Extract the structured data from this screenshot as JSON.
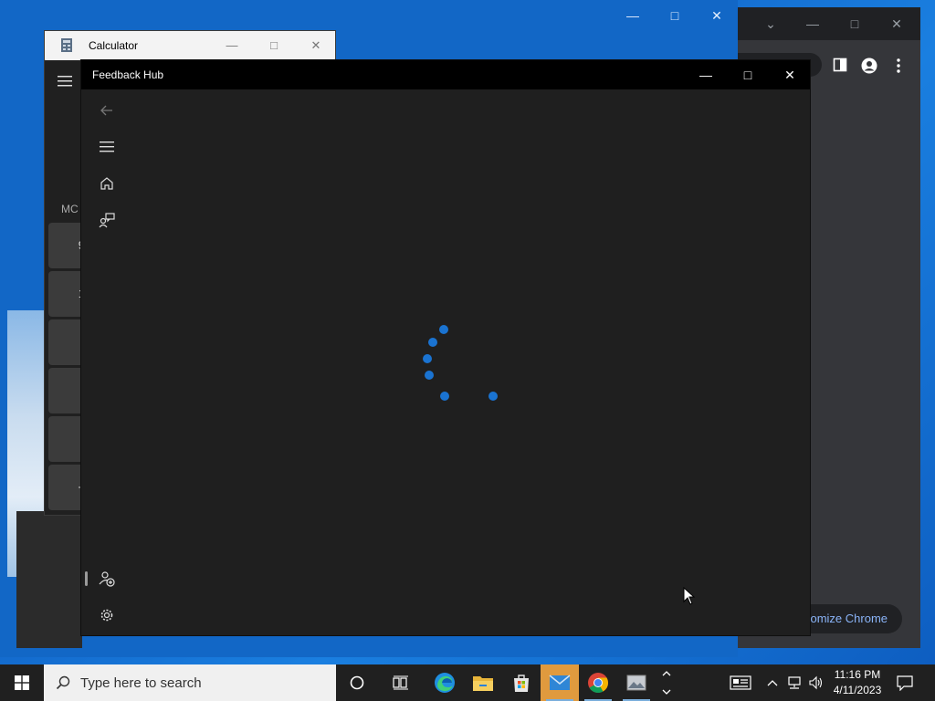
{
  "calculator": {
    "title": "Calculator",
    "memory_label": "MC",
    "keys": [
      "9",
      "1",
      "",
      "",
      "",
      "+"
    ]
  },
  "feedback_hub": {
    "title": "Feedback Hub"
  },
  "chrome": {
    "customize_label": "tomize Chrome"
  },
  "taskbar": {
    "search_placeholder": "Type here to search",
    "time": "11:16 PM",
    "date": "4/11/2023"
  },
  "colors": {
    "accent": "#1a73d1",
    "taskbar": "#202020",
    "fh_background": "#1f1f1f"
  },
  "icons": [
    "back-arrow-icon",
    "hamburger-icon",
    "home-icon",
    "feedback-icon",
    "add-person-icon",
    "gear-icon",
    "windows-logo-icon",
    "search-icon",
    "cortana-icon",
    "task-view-icon",
    "edge-icon",
    "file-explorer-icon",
    "store-icon",
    "mail-icon",
    "chrome-icon",
    "photos-icon",
    "news-icon",
    "chevron-up-icon",
    "network-icon",
    "volume-icon",
    "notification-icon"
  ]
}
